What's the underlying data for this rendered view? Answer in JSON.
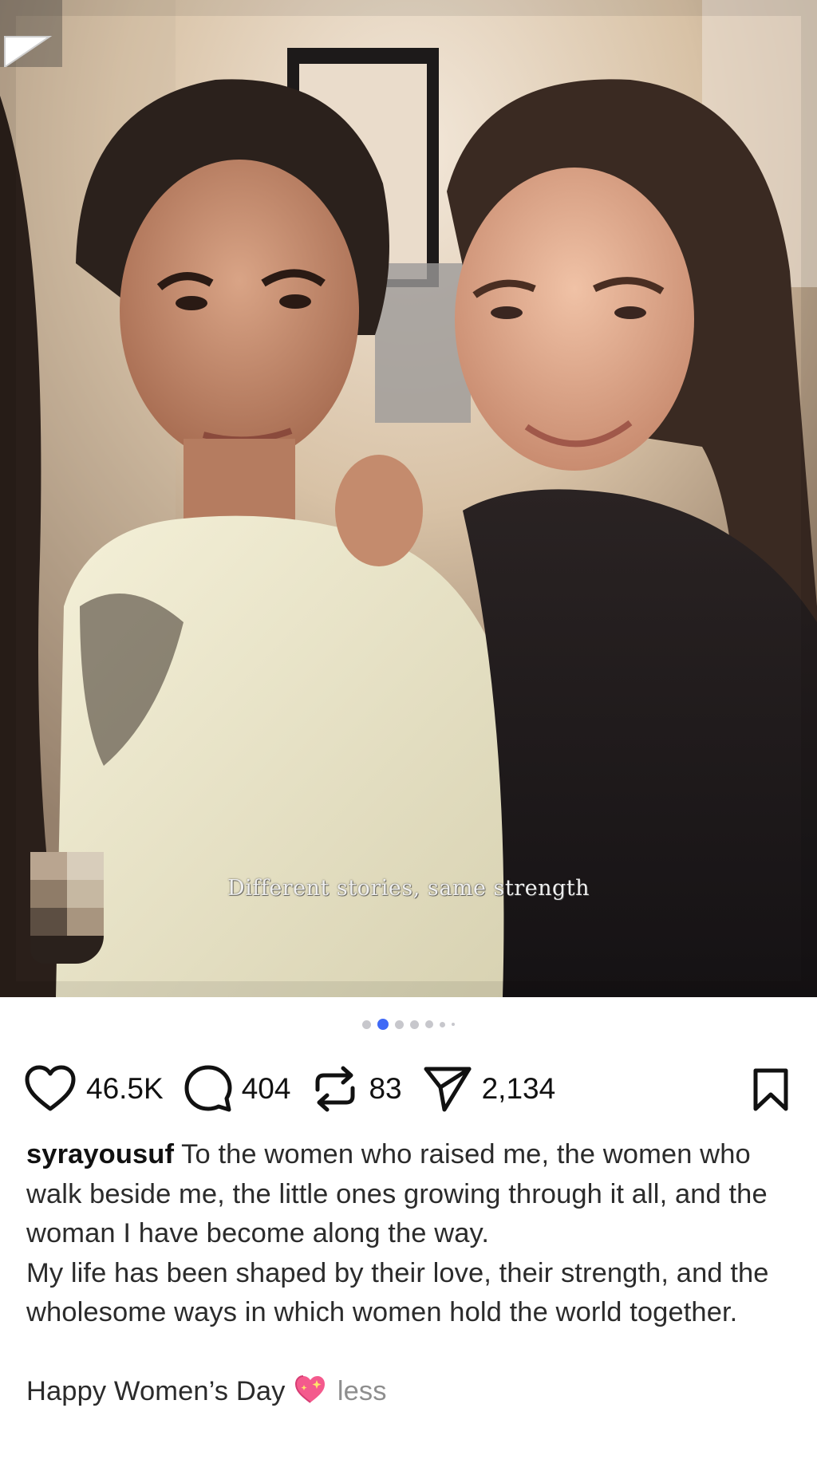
{
  "post": {
    "overlay_text": "Different stories, same strength",
    "carousel": {
      "total": 7,
      "active_index": 1
    },
    "likes": "46.5K",
    "comments": "404",
    "reposts": "83",
    "shares": "2,134",
    "caption": {
      "username": "syrayousuf",
      "paragraphs": [
        "To the women who raised me, the women who walk beside me, the little ones growing through it all, and the woman I have become along the way.",
        "My life has been shaped by their love, their strength, and the wholesome ways in which women hold the world together.",
        "",
        "Happy Women’s Day"
      ],
      "emoji": "sparkling-heart",
      "less_label": "less"
    },
    "icons": {
      "like": "heart-icon",
      "comment": "comment-bubble-icon",
      "repost": "repost-icon",
      "share": "send-icon",
      "save": "bookmark-icon"
    }
  }
}
